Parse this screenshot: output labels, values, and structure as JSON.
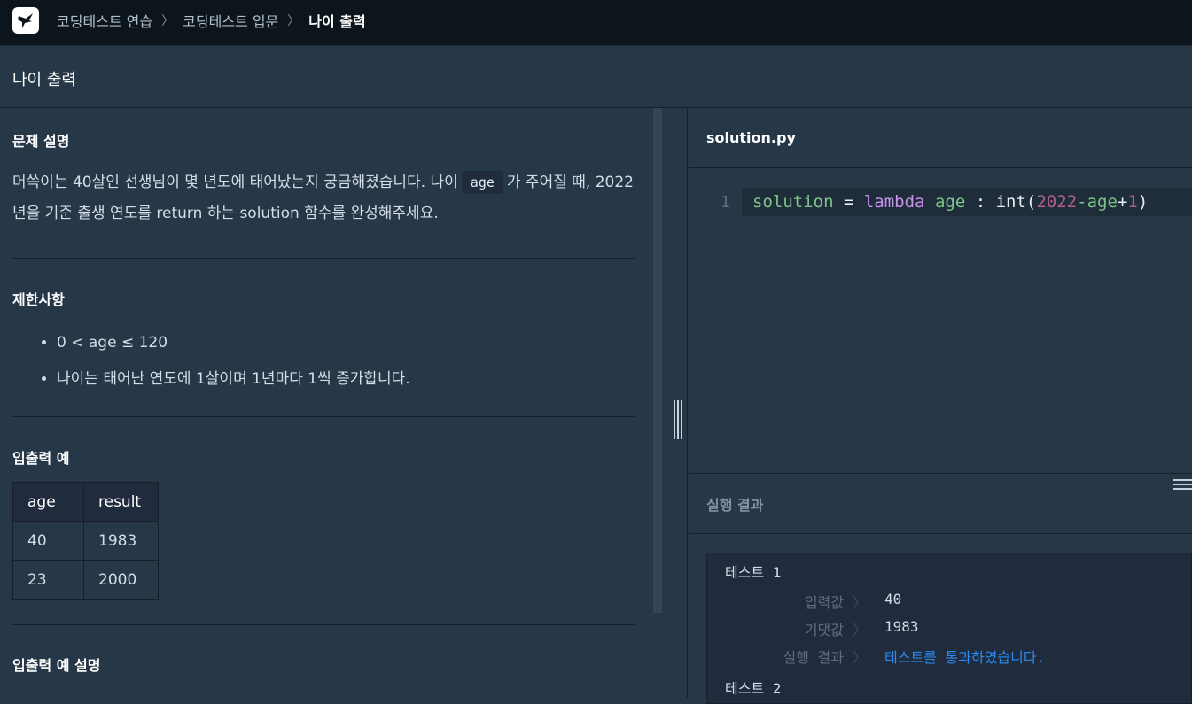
{
  "breadcrumbs": [
    "코딩테스트 연습",
    "코딩테스트 입문",
    "나이 출력"
  ],
  "page_title": "나이 출력",
  "problem": {
    "desc_heading": "문제 설명",
    "desc_part1": "머쓱이는 40살인 선생님이 몇 년도에 태어났는지 궁금해졌습니다. 나이",
    "desc_param": "age",
    "desc_part2": "가 주어질 때, 2022년을 기준 출생 연도를 return 하는 solution 함수를 완성해주세요.",
    "constraints_heading": "제한사항",
    "constraints": [
      "0 < age ≤ 120",
      "나이는 태어난 연도에 1살이며 1년마다 1씩 증가합니다."
    ],
    "io_heading": "입출력 예",
    "io_headers": [
      "age",
      "result"
    ],
    "io_rows": [
      [
        "40",
        "1983"
      ],
      [
        "23",
        "2000"
      ]
    ],
    "io_desc_heading": "입출력 예 설명"
  },
  "editor": {
    "filename": "solution.py",
    "line_number": "1",
    "tokens": {
      "var": "solution",
      "eq": " = ",
      "kw": "lambda",
      "param": "age",
      "colon": " : ",
      "fn": "int(",
      "num1": "2022",
      "minus": "-",
      "param2": "age",
      "plus": "+",
      "num2": "1",
      "close": ")"
    }
  },
  "results": {
    "title": "실행 결과",
    "tests": [
      {
        "name": "테스트 1",
        "input_label": "입력값",
        "input": "40",
        "expected_label": "기댓값",
        "expected": "1983",
        "result_label": "실행 결과",
        "result": "테스트를 통과하였습니다."
      },
      {
        "name": "테스트 2"
      }
    ]
  },
  "colors": {
    "background": "#263747",
    "topbar": "#0c151c",
    "pass": "#2b8cf2",
    "keyword": "#c792ea",
    "variable": "#7cc48a",
    "number": "#b0608a"
  },
  "icons": [
    "logo-icon",
    "chevron-right-icon",
    "resize-grip-icon",
    "menu-icon"
  ]
}
